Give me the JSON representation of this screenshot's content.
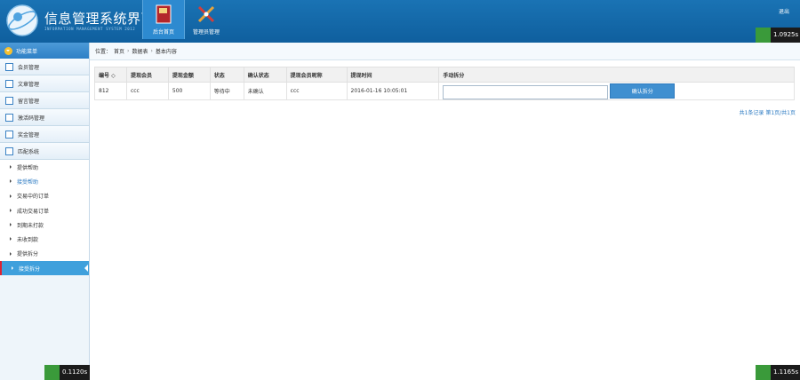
{
  "header": {
    "title": "信息管理系统界面",
    "subtitle": "INFORMATION MANAGEMENT SYSTEM 2012",
    "nav": [
      {
        "label": "后台首页",
        "icon": "book-icon",
        "active": true
      },
      {
        "label": "管理员管理",
        "icon": "tools-icon",
        "active": false
      }
    ],
    "logout_label": "退出",
    "timer_label": "1.0925s"
  },
  "sidebar": {
    "heading": "功能菜单",
    "items": [
      {
        "label": "会员管理"
      },
      {
        "label": "文章管理"
      },
      {
        "label": "留言管理"
      },
      {
        "label": "激活码管理"
      },
      {
        "label": "奖金管理"
      },
      {
        "label": "匹配系统"
      }
    ],
    "sub_items": [
      {
        "label": "提供帮助"
      },
      {
        "label": "接受帮助"
      },
      {
        "label": "交易中的订单"
      },
      {
        "label": "成功交易订单"
      },
      {
        "label": "到期未打款"
      },
      {
        "label": "未收到款"
      },
      {
        "label": "提供拆分"
      },
      {
        "label": "接受拆分"
      }
    ],
    "timer_label": "0.1120s"
  },
  "breadcrumb": {
    "prefix": "位置：",
    "items": [
      "首页",
      "数据表",
      "基本内容"
    ]
  },
  "table": {
    "headers": [
      "编号 ◇",
      "提现会员",
      "提现金额",
      "状态",
      "确认状态",
      "提现会员昵称",
      "提现时间",
      "手动拆分"
    ],
    "rows": [
      {
        "id": "812",
        "member": "ccc",
        "amount": "500",
        "status": "等待中",
        "confirm": "未确认",
        "nickname": "ccc",
        "time": "2016-01-16 10:05:01"
      }
    ],
    "split_placeholder": "",
    "confirm_label": "确认拆分"
  },
  "pager": {
    "text": "共1条记录 第1页/共1页"
  },
  "bottom_timer_label": "1.1165s"
}
